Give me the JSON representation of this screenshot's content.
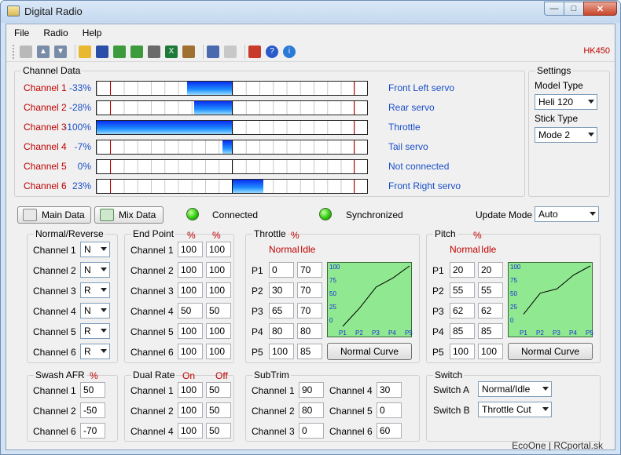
{
  "window": {
    "title": "Digital Radio",
    "model_tag": "HK450"
  },
  "menu": [
    "File",
    "Radio",
    "Help"
  ],
  "toolbar_icons": [
    "radio-icon",
    "upload-icon",
    "download-icon",
    "open-folder-icon",
    "save-icon",
    "copy-icon",
    "paste-icon",
    "print-icon",
    "excel-icon",
    "tools-icon",
    "fullscreen-icon",
    "window-icon",
    "toolbox-icon",
    "help-icon",
    "info-icon"
  ],
  "channel_data": {
    "legend": "Channel Data",
    "channels": [
      {
        "name": "Channel 1",
        "pct": "-33%",
        "value": -33,
        "desc": "Front Left servo"
      },
      {
        "name": "Channel 2",
        "pct": "-28%",
        "value": -28,
        "desc": "Rear servo"
      },
      {
        "name": "Channel 3",
        "pct": "-100%",
        "value": -100,
        "desc": "Throttle"
      },
      {
        "name": "Channel 4",
        "pct": "-7%",
        "value": -7,
        "desc": "Tail servo"
      },
      {
        "name": "Channel 5",
        "pct": "0%",
        "value": 0,
        "desc": "Not connected"
      },
      {
        "name": "Channel 6",
        "pct": "23%",
        "value": 23,
        "desc": "Front Right servo"
      }
    ]
  },
  "settings": {
    "legend": "Settings",
    "model_type_label": "Model Type",
    "model_type": "Heli 120",
    "stick_type_label": "Stick Type",
    "stick_type": "Mode 2"
  },
  "tabs": {
    "main": "Main Data",
    "mix": "Mix Data"
  },
  "status": {
    "connected": "Connected",
    "synchronized": "Synchronized",
    "update_mode_label": "Update Mode",
    "update_mode": "Auto"
  },
  "normal_reverse": {
    "legend": "Normal/Reverse",
    "rows": [
      {
        "name": "Channel 1",
        "val": "N"
      },
      {
        "name": "Channel 2",
        "val": "N"
      },
      {
        "name": "Channel 3",
        "val": "R"
      },
      {
        "name": "Channel 4",
        "val": "N"
      },
      {
        "name": "Channel 5",
        "val": "R"
      },
      {
        "name": "Channel 6",
        "val": "R"
      }
    ]
  },
  "end_point": {
    "legend": "End Point",
    "col1": "%",
    "col2": "%",
    "rows": [
      {
        "name": "Channel 1",
        "a": "100",
        "b": "100"
      },
      {
        "name": "Channel 2",
        "a": "100",
        "b": "100"
      },
      {
        "name": "Channel 3",
        "a": "100",
        "b": "100"
      },
      {
        "name": "Channel 4",
        "a": "50",
        "b": "50"
      },
      {
        "name": "Channel 5",
        "a": "100",
        "b": "100"
      },
      {
        "name": "Channel 6",
        "a": "100",
        "b": "100"
      }
    ]
  },
  "throttle": {
    "legend": "Throttle",
    "pct": "%",
    "col1": "Normal",
    "col2": "Idle",
    "button": "Normal Curve",
    "rows": [
      {
        "name": "P1",
        "a": "0",
        "b": "70"
      },
      {
        "name": "P2",
        "a": "30",
        "b": "70"
      },
      {
        "name": "P3",
        "a": "65",
        "b": "70"
      },
      {
        "name": "P4",
        "a": "80",
        "b": "80"
      },
      {
        "name": "P5",
        "a": "100",
        "b": "85"
      }
    ]
  },
  "pitch": {
    "legend": "Pitch",
    "pct": "%",
    "col1": "Normal",
    "col2": "Idle",
    "button": "Normal Curve",
    "rows": [
      {
        "name": "P1",
        "a": "20",
        "b": "20"
      },
      {
        "name": "P2",
        "a": "55",
        "b": "55"
      },
      {
        "name": "P3",
        "a": "62",
        "b": "62"
      },
      {
        "name": "P4",
        "a": "85",
        "b": "85"
      },
      {
        "name": "P5",
        "a": "100",
        "b": "100"
      }
    ]
  },
  "graph_labels": {
    "y": [
      "100",
      "75",
      "50",
      "25",
      "0"
    ],
    "x": [
      "P1",
      "P2",
      "P3",
      "P4",
      "P5"
    ]
  },
  "swash_afr": {
    "legend": "Swash AFR",
    "pct": "%",
    "rows": [
      {
        "name": "Channel 1",
        "val": "50"
      },
      {
        "name": "Channel 2",
        "val": "-50"
      },
      {
        "name": "Channel 6",
        "val": "-70"
      }
    ]
  },
  "dual_rate": {
    "legend": "Dual Rate",
    "col1": "On",
    "col2": "Off",
    "rows": [
      {
        "name": "Channel 1",
        "a": "100",
        "b": "50"
      },
      {
        "name": "Channel 2",
        "a": "100",
        "b": "50"
      },
      {
        "name": "Channel 4",
        "a": "100",
        "b": "50"
      }
    ]
  },
  "subtrim": {
    "legend": "SubTrim",
    "rows": [
      {
        "n1": "Channel 1",
        "v1": "90",
        "n2": "Channel 4",
        "v2": "30"
      },
      {
        "n1": "Channel 2",
        "v1": "80",
        "n2": "Channel 5",
        "v2": "0"
      },
      {
        "n1": "Channel 3",
        "v1": "0",
        "n2": "Channel 6",
        "v2": "60"
      }
    ]
  },
  "switch": {
    "legend": "Switch",
    "a_label": "Switch A",
    "a_val": "Normal/Idle",
    "b_label": "Switch B",
    "b_val": "Throttle Cut"
  },
  "footer": "EcoOne | RCportal.sk"
}
